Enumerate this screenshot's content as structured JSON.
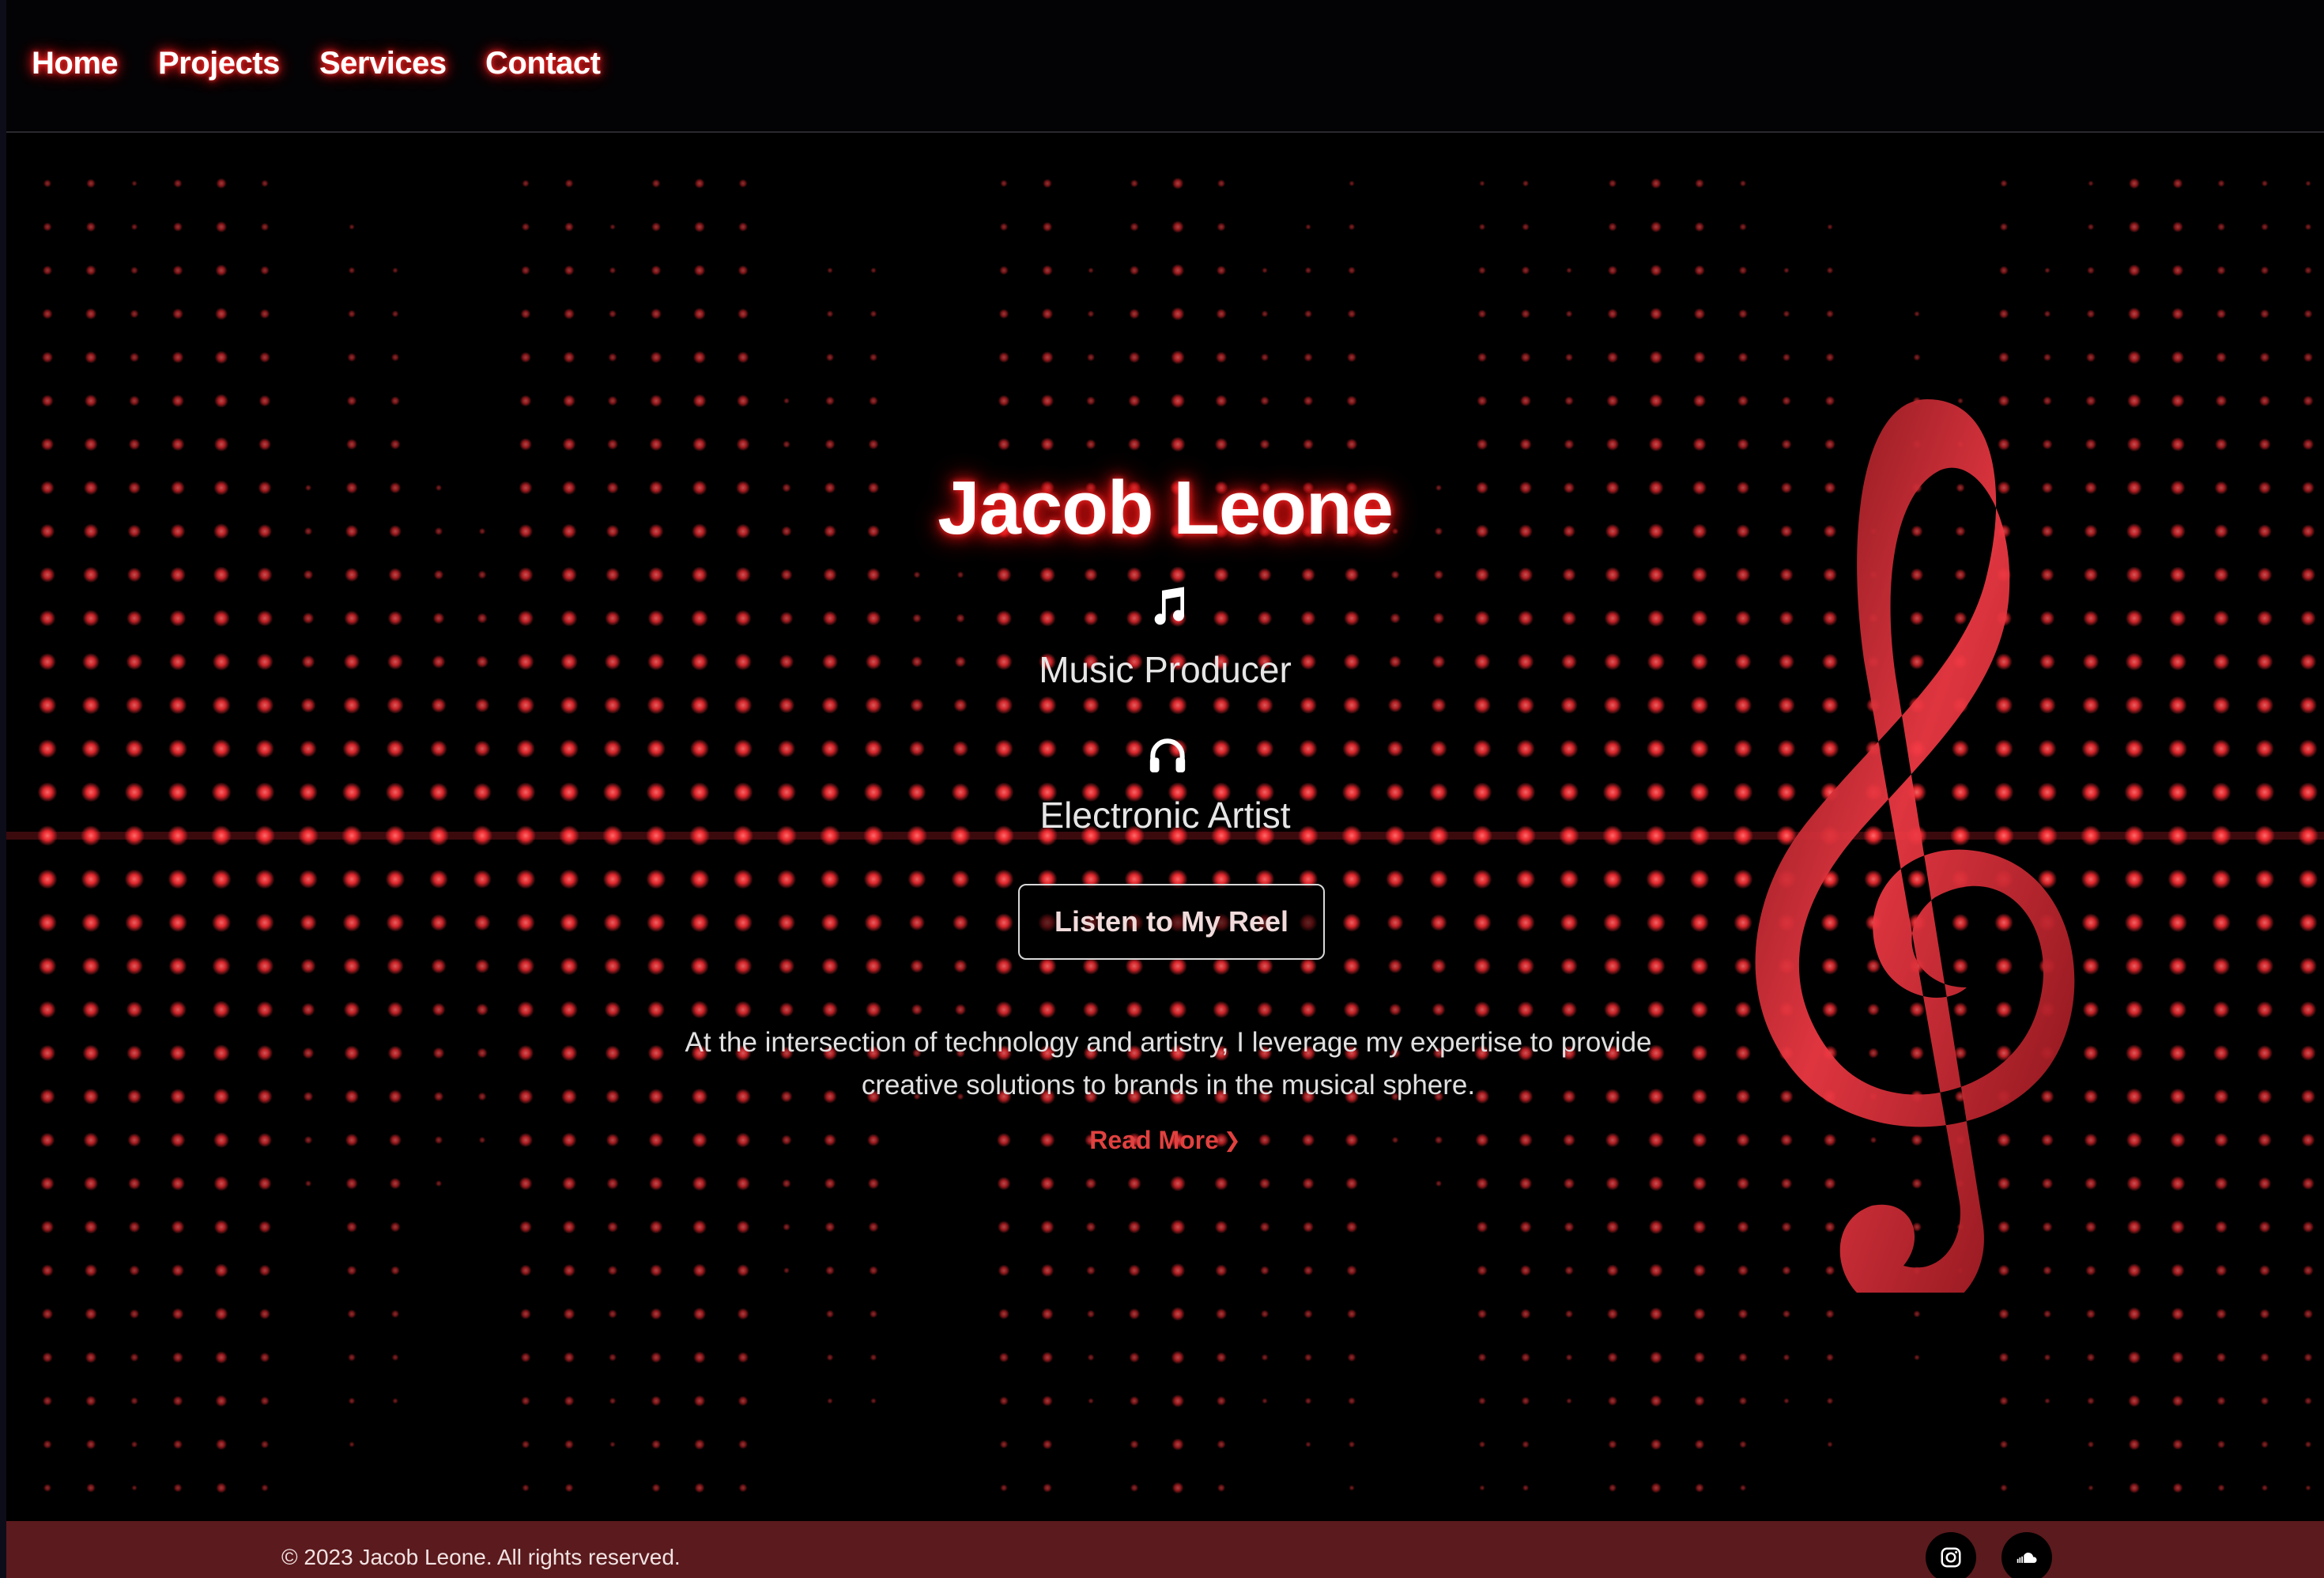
{
  "nav": {
    "items": [
      {
        "label": "Home"
      },
      {
        "label": "Projects"
      },
      {
        "label": "Services"
      },
      {
        "label": "Contact"
      }
    ]
  },
  "hero": {
    "name": "Jacob Leone",
    "roles": [
      {
        "icon": "music-note-icon",
        "label": "Music Producer"
      },
      {
        "icon": "headphones-icon",
        "label": "Electronic Artist"
      }
    ],
    "cta_label": "Listen to My Reel",
    "about": "At the intersection of technology and artistry, I leverage my expertise to provide creative solutions to brands in the musical sphere.",
    "read_more": "Read More",
    "background_icon": "treble-clef-icon"
  },
  "footer": {
    "copyright": "© 2023 Jacob Leone. All rights reserved.",
    "social": [
      {
        "icon": "instagram-icon"
      },
      {
        "icon": "soundcloud-icon"
      }
    ]
  },
  "colors": {
    "accent": "#e0413f",
    "glow": "#ff2a2a",
    "background": "#000000",
    "footer": "#5b1a1d"
  }
}
